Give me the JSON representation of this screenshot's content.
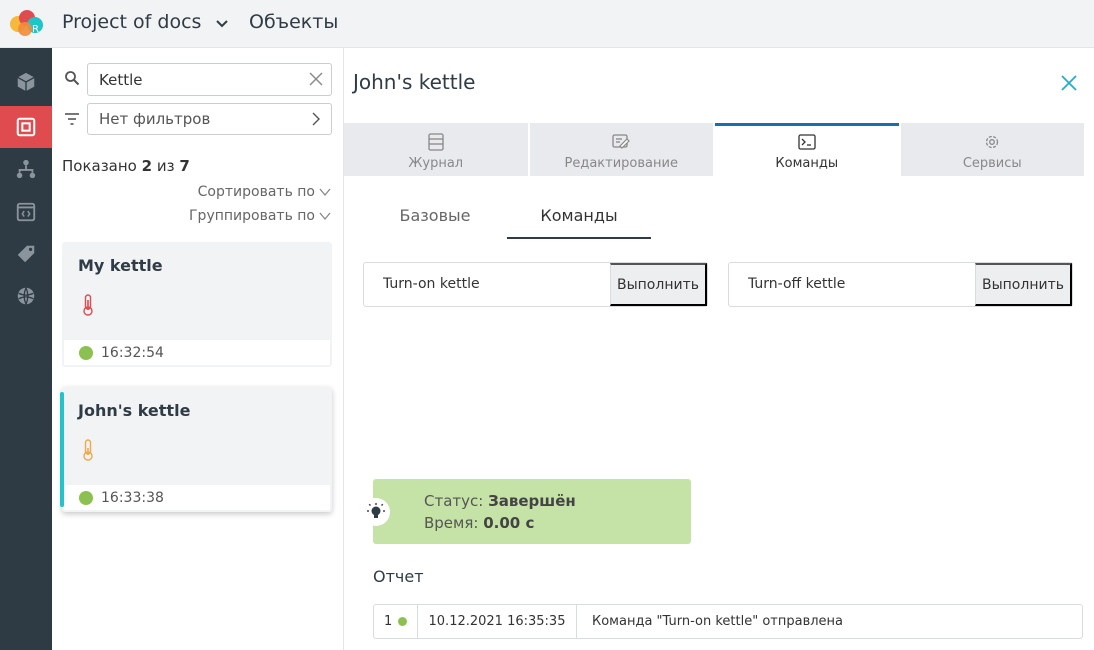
{
  "header": {
    "project_title": "Project of docs",
    "section_title": "Объекты"
  },
  "sidebar": {
    "items": [
      {
        "icon": "cube-icon",
        "active": false
      },
      {
        "icon": "object-square-icon",
        "active": true
      },
      {
        "icon": "hierarchy-icon",
        "active": false
      },
      {
        "icon": "code-window-icon",
        "active": false
      },
      {
        "icon": "tag-icon",
        "active": false
      },
      {
        "icon": "globe-icon",
        "active": false
      }
    ]
  },
  "list": {
    "search_value": "Kettle",
    "filter_label": "Нет фильтров",
    "shown_prefix": "Показано",
    "shown_count": "2",
    "shown_of": "из",
    "shown_total": "7",
    "sort_label": "Сортировать по",
    "group_label": "Группировать по",
    "items": [
      {
        "title": "My kettle",
        "time": "16:32:54",
        "therm_color": "#e04b4f"
      },
      {
        "title": "John's kettle",
        "time": "16:33:38",
        "therm_color": "#f0a84a"
      }
    ]
  },
  "detail": {
    "title": "John's kettle",
    "tabs": [
      {
        "label": "Журнал",
        "icon": "journal-icon"
      },
      {
        "label": "Редактирование",
        "icon": "edit-icon"
      },
      {
        "label": "Команды",
        "icon": "terminal-icon"
      },
      {
        "label": "Сервисы",
        "icon": "services-gear-icon"
      }
    ],
    "active_tab": "Команды",
    "subtabs": [
      {
        "label": "Базовые"
      },
      {
        "label": "Команды"
      }
    ],
    "commands": [
      {
        "label": "Turn-on kettle",
        "button": "Выполнить"
      },
      {
        "label": "Turn-off kettle",
        "button": "Выполнить"
      }
    ],
    "status": {
      "status_label": "Статус:",
      "status_value": "Завершён",
      "time_label": "Время:",
      "time_value": "0.00 с"
    },
    "report": {
      "title": "Отчет",
      "rows": [
        {
          "num": "1",
          "datetime": "10.12.2021 16:35:35",
          "message": "Команда \"Turn-on kettle\" отправлена"
        }
      ]
    }
  },
  "colors": {
    "accent_red": "#e04b4f",
    "accent_teal": "#20c4c9",
    "accent_blue": "#1c6fa6",
    "status_green": "#8cc152",
    "status_bg": "#c5e3a6",
    "rail_bg": "#2e3a44"
  }
}
